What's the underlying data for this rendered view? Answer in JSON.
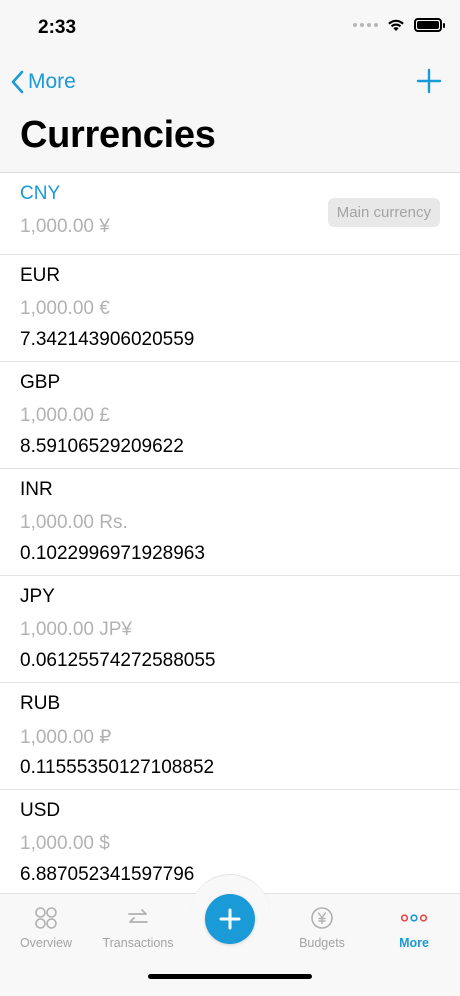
{
  "status": {
    "time": "2:33"
  },
  "nav": {
    "back_label": "More",
    "title": "Currencies"
  },
  "main_currency": {
    "code": "CNY",
    "amount": "1,000.00 ¥",
    "badge": "Main currency"
  },
  "currencies": [
    {
      "code": "EUR",
      "amount": "1,000.00 €",
      "rate": "7.342143906020559"
    },
    {
      "code": "GBP",
      "amount": "1,000.00 £",
      "rate": "8.59106529209622"
    },
    {
      "code": "INR",
      "amount": "1,000.00 Rs.",
      "rate": "0.1022996971928963"
    },
    {
      "code": "JPY",
      "amount": "1,000.00 JP¥",
      "rate": "0.06125574272588055"
    },
    {
      "code": "RUB",
      "amount": "1,000.00 ₽",
      "rate": "0.11555350127108852"
    },
    {
      "code": "USD",
      "amount": "1,000.00 $",
      "rate": "6.887052341597796"
    }
  ],
  "tabs": {
    "overview": "Overview",
    "transactions": "Transactions",
    "budgets": "Budgets",
    "more": "More"
  },
  "colors": {
    "accent": "#1a9ad6",
    "more_dot_red": "#e64b4b",
    "more_dot_blue": "#1a9ad6"
  }
}
